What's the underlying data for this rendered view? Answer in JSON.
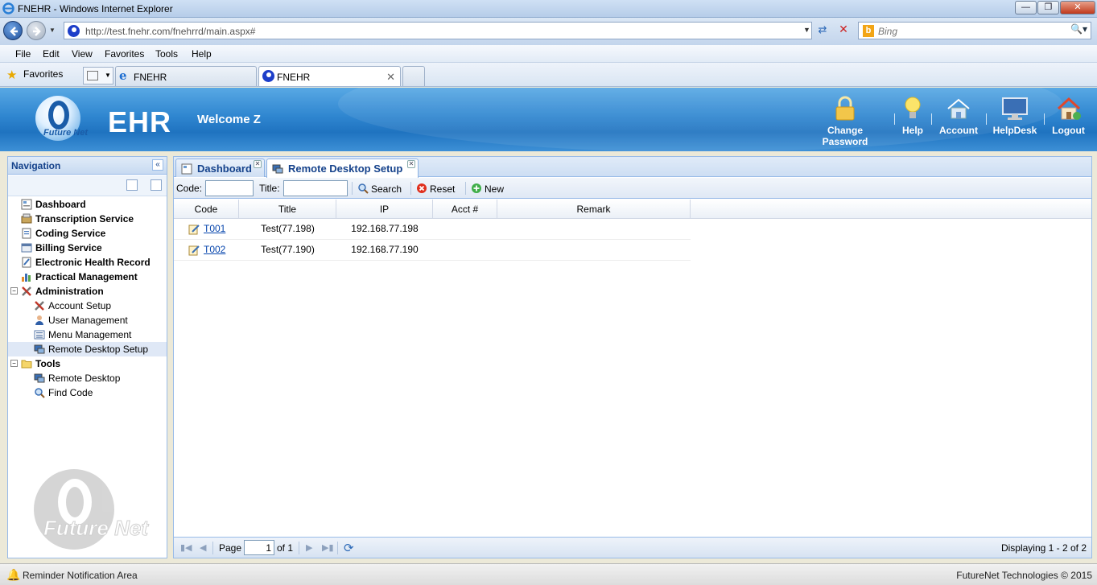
{
  "window": {
    "title": "FNEHR - Windows Internet Explorer"
  },
  "addressbar": {
    "url": "http://test.fnehr.com/fnehrrd/main.aspx#",
    "search_placeholder": "Bing"
  },
  "menubar": {
    "items": [
      "File",
      "Edit",
      "View",
      "Favorites",
      "Tools",
      "Help"
    ]
  },
  "favbar": {
    "favorites_label": "Favorites",
    "tabs": [
      {
        "label": "FNEHR"
      },
      {
        "label": "FNEHR"
      }
    ]
  },
  "header": {
    "logo_text": "Future Net",
    "app_title": "EHR",
    "welcome": "Welcome Z",
    "links": [
      {
        "label": "Change Password",
        "icon": "lock-icon"
      },
      {
        "label": "Help",
        "icon": "lightbulb-icon"
      },
      {
        "label": "Account",
        "icon": "house-icon"
      },
      {
        "label": "HelpDesk",
        "icon": "monitor-icon"
      },
      {
        "label": "Logout",
        "icon": "home-exit-icon"
      }
    ]
  },
  "navigation": {
    "title": "Navigation",
    "items": [
      {
        "label": "Dashboard",
        "icon": "dashboard-icon",
        "level": 0
      },
      {
        "label": "Transcription Service",
        "icon": "transcription-icon",
        "level": 0
      },
      {
        "label": "Coding Service",
        "icon": "coding-icon",
        "level": 0
      },
      {
        "label": "Billing Service",
        "icon": "billing-icon",
        "level": 0
      },
      {
        "label": "Electronic Health Record",
        "icon": "ehr-icon",
        "level": 0
      },
      {
        "label": "Practical Management",
        "icon": "chart-icon",
        "level": 0
      },
      {
        "label": "Administration",
        "icon": "tools-icon",
        "level": 0,
        "expanded": true
      },
      {
        "label": "Account Setup",
        "icon": "tools-icon",
        "level": 1
      },
      {
        "label": "User Management",
        "icon": "user-icon",
        "level": 1
      },
      {
        "label": "Menu Management",
        "icon": "menu-icon",
        "level": 1
      },
      {
        "label": "Remote Desktop Setup",
        "icon": "remote-desktop-icon",
        "level": 1,
        "selected": true
      },
      {
        "label": "Tools",
        "icon": "folder-icon",
        "level": 0,
        "expanded": true
      },
      {
        "label": "Remote Desktop",
        "icon": "remote-desktop-icon",
        "level": 1
      },
      {
        "label": "Find Code",
        "icon": "magnifier-icon",
        "level": 1
      }
    ],
    "watermark": "Future Net"
  },
  "main": {
    "tabs": [
      {
        "label": "Dashboard",
        "active": false
      },
      {
        "label": "Remote Desktop Setup",
        "active": true
      }
    ],
    "toolbar": {
      "code_label": "Code:",
      "title_label": "Title:",
      "code_value": "",
      "title_value": "",
      "search_label": "Search",
      "reset_label": "Reset",
      "new_label": "New"
    },
    "grid": {
      "columns": [
        "Code",
        "Title",
        "IP",
        "Acct #",
        "Remark"
      ],
      "rows": [
        {
          "code": "T001",
          "title": "Test(77.198)",
          "ip": "192.168.77.198",
          "acct": "",
          "remark": ""
        },
        {
          "code": "T002",
          "title": "Test(77.190)",
          "ip": "192.168.77.190",
          "acct": "",
          "remark": ""
        }
      ]
    },
    "pager": {
      "page_label": "Page",
      "current_page": "1",
      "of_label": "of 1",
      "info": "Displaying 1 - 2 of 2"
    }
  },
  "statusbar": {
    "left": "Reminder Notification Area",
    "right": "FutureNet Technologies © 2015"
  },
  "colors": {
    "header_blue": "#2f86d0",
    "panel_border": "#99bbe8",
    "panel_title": "#15428b",
    "link": "#0645ad"
  }
}
